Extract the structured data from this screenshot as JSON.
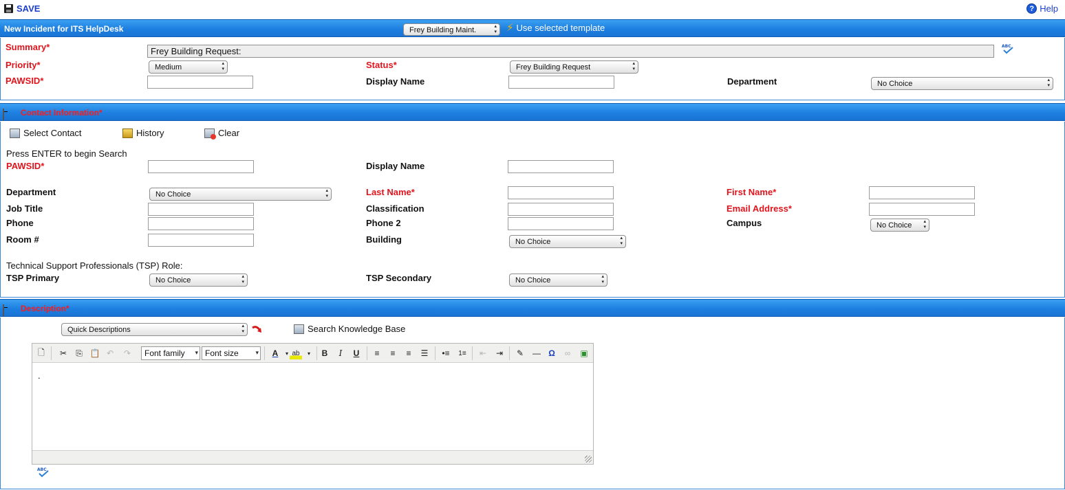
{
  "topbar": {
    "save_label": "SAVE",
    "help_label": "Help"
  },
  "header": {
    "title": "New Incident for ITS HelpDesk",
    "template_select": "Frey Building Maint.",
    "use_template_label": "Use selected template"
  },
  "incident": {
    "summary_label": "Summary*",
    "summary_value": "Frey Building Request:",
    "priority_label": "Priority*",
    "priority_value": "Medium",
    "status_label": "Status*",
    "status_value": "Frey Building Request",
    "pawsid_label": "PAWSID*",
    "display_name_label": "Display Name",
    "department_label": "Department",
    "department_value": "No Choice"
  },
  "contact": {
    "section_title": "Contact Information*",
    "select_contact_label": "Select Contact",
    "history_label": "History",
    "clear_label": "Clear",
    "search_hint": "Press ENTER to begin Search",
    "pawsid_label": "PAWSID*",
    "display_name_label": "Display Name",
    "department_label": "Department",
    "department_value": "No Choice",
    "last_name_label": "Last Name*",
    "first_name_label": "First Name*",
    "job_title_label": "Job Title",
    "classification_label": "Classification",
    "email_label": "Email Address*",
    "phone_label": "Phone",
    "phone2_label": "Phone 2",
    "campus_label": "Campus",
    "campus_value": "No Choice",
    "room_label": "Room #",
    "building_label": "Building",
    "building_value": "No Choice",
    "tsp_heading": "Technical Support Professionals (TSP) Role:",
    "tsp_primary_label": "TSP Primary",
    "tsp_primary_value": "No Choice",
    "tsp_secondary_label": "TSP Secondary",
    "tsp_secondary_value": "No Choice"
  },
  "description": {
    "section_title": "Description*",
    "quick_desc_value": "Quick Descriptions",
    "search_kb_label": "Search Knowledge Base",
    "font_family_label": "Font family",
    "font_size_label": "Font size",
    "content": "."
  },
  "colors": {
    "bar_blue": "#1d7fe0",
    "required_red": "#e0141c",
    "link_blue": "#1c3fc9"
  }
}
